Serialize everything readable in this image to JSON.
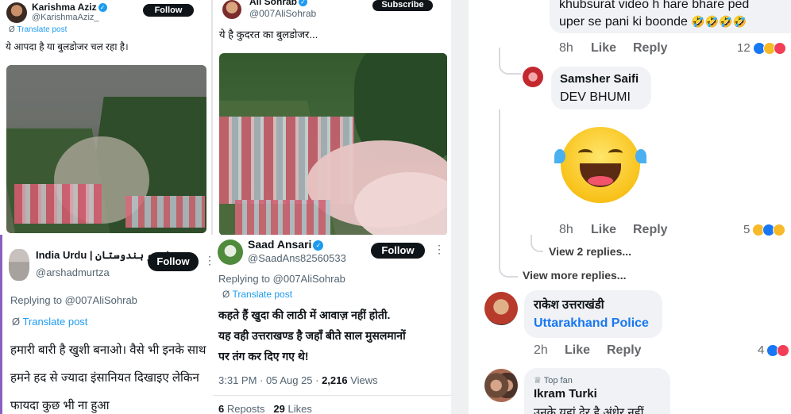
{
  "tweet1": {
    "name": "Karishma Aziz",
    "handle": "@KarishmaAziz_",
    "follow": "Follow",
    "translate": "Translate post",
    "text": "ये आपदा है या बुलडोजर चल रहा है।"
  },
  "tweet2": {
    "name": "Ali Sohrab",
    "handle": "@007AliSohrab",
    "subscribe": "Subscribe",
    "text": "ये है कुदरत का बुलडोजर..."
  },
  "tweet3": {
    "name": "India Urdu | اردو ہندوستان",
    "handle": "@arshadmurtza",
    "follow": "Follow",
    "replying": "Replying to @007AliSohrab",
    "translate": "Translate post",
    "line1": "हमारी बारी है खुशी बनाओ। वैसे भी इनके साथ",
    "line2": "हमने हद से ज्यादा इंसानियत दिखाइए लेकिन",
    "line3": "फायदा कुछ भी ना हुआ"
  },
  "tweet4": {
    "name": "Saad Ansari",
    "handle": "@SaadAns82560533",
    "follow": "Follow",
    "replying": "Replying to @007AliSohrab",
    "translate": "Translate post",
    "line1": "कहते हैं खुदा की लाठी में आवाज़ नहीं होती.",
    "line2": "यह वही उत्तराखण्ड है जहाँ बीते साल मुसलमानों",
    "line3": "पर तंग कर दिए गए थे!",
    "meta": "3:31 PM · 05 Aug 25 · ",
    "views_count": "2,216",
    "views_label": " Views",
    "reposts_count": "6",
    "reposts_label": " Reposts",
    "likes_count": "29",
    "likes_label": " Likes"
  },
  "fb": {
    "c1_line1": "khubsurat video h hare bhare ped",
    "c1_line2": "uper se pani ki boonde",
    "c1_emoji": "🤣🤣🤣🤣",
    "c1_time": "8h",
    "c1_like": "Like",
    "c1_reply": "Reply",
    "c1_count": "12",
    "c2_name": "Samsher Saifi",
    "c2_text": "DEV BHUMI",
    "c2_time": "8h",
    "c2_like": "Like",
    "c2_reply": "Reply",
    "c2_count": "5",
    "view_replies": "View 2 replies...",
    "view_more": "View more replies...",
    "c3_name": "राकेश उत्तराखंडी",
    "c3_tag": "Uttarakhand Police",
    "c3_time": "2h",
    "c3_like": "Like",
    "c3_reply": "Reply",
    "c3_count": "4",
    "c4_badge": "Top fan",
    "c4_name": "Ikram Turki",
    "c4_text": "उनके यहां देर है अंधेर नहीं"
  }
}
